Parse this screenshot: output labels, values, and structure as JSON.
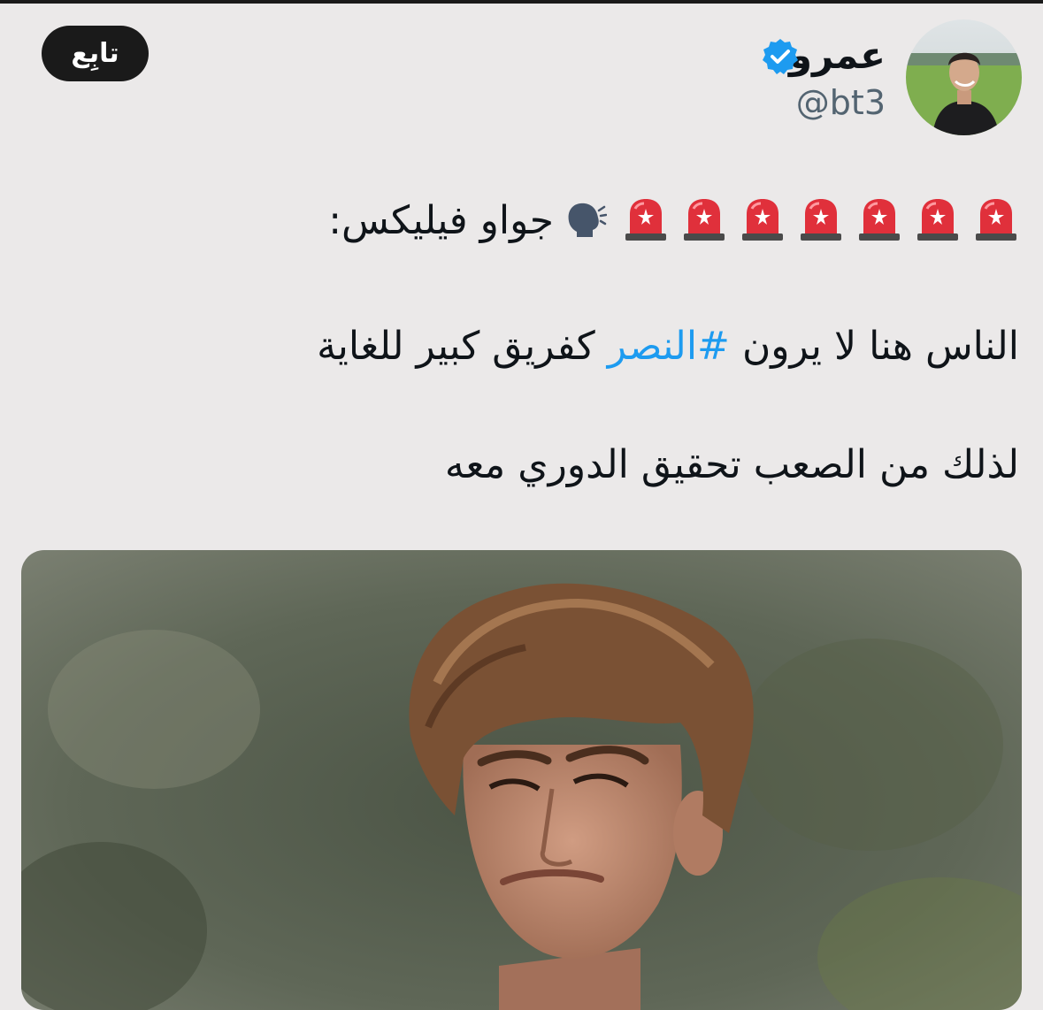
{
  "header": {
    "display_name": "عمرو",
    "handle": "@bt3",
    "follow_label": "تابِع",
    "verified": true
  },
  "tweet": {
    "line1_text": "جواو فيليكس:",
    "line1_emojis": [
      "siren-icon",
      "siren-icon",
      "siren-icon",
      "siren-icon",
      "siren-icon",
      "siren-icon",
      "siren-icon",
      "speaking-head-icon"
    ],
    "line2_before": "الناس هنا لا يرون",
    "hashtag": "#النصر",
    "line2_after": "كفريق كبير للغاية",
    "line3": "لذلك من الصعب تحقيق الدوري معه"
  },
  "colors": {
    "background": "#ebe9e9",
    "hashtag": "#1d9bf0",
    "verified_badge": "#1d9bf0",
    "follow_button": "#1a1a1a"
  }
}
